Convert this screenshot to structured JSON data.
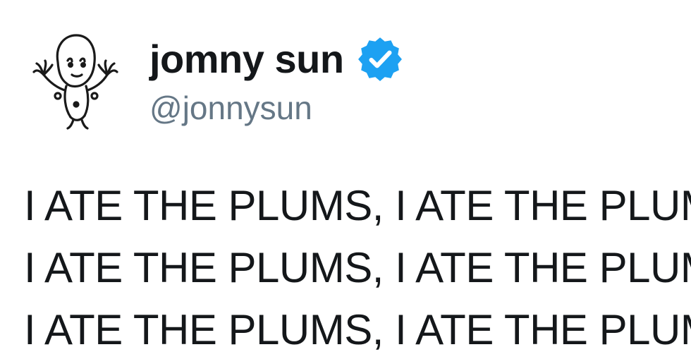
{
  "author": {
    "display_name": "jomny sun",
    "handle": "@jonnysun",
    "verified": true,
    "verified_badge_color": "#1da1f2",
    "avatar_icon": "alien-doodle-avatar"
  },
  "tweet": {
    "lines": [
      "I ATE THE PLUMS, I ATE THE PLUMS, I ATE THE PLUMS",
      "I ATE THE PLUMS, I ATE THE PLUMS, I ATE THE PLUMS",
      "I ATE THE PLUMS, I ATE THE PLUMS, I ATE THE PLUMS"
    ]
  },
  "colors": {
    "text": "#14171a",
    "secondary": "#657786",
    "background": "#ffffff"
  }
}
